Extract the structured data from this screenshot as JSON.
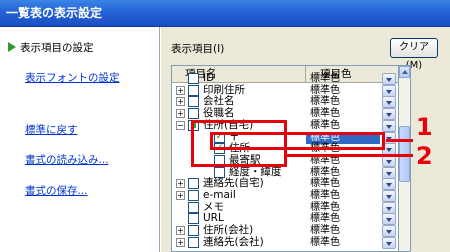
{
  "window": {
    "title": "一覧表の表示設定"
  },
  "sidebar": {
    "current": "表示項目の設定",
    "links": [
      {
        "label": "表示フォントの設定"
      },
      {
        "label": "標準に戻す"
      },
      {
        "label": "書式の読み込み..."
      },
      {
        "label": "書式の保存..."
      }
    ]
  },
  "main": {
    "label": "表示項目(I)",
    "clear_button": "クリア(M)",
    "columns": {
      "name": "項目名",
      "color": "項目色"
    },
    "rows": [
      {
        "name": "ID",
        "color": "標準色",
        "expander": "",
        "checked": false
      },
      {
        "name": "印刷住所",
        "color": "標準色",
        "expander": "+",
        "checked": false
      },
      {
        "name": "会社名",
        "color": "標準色",
        "expander": "+",
        "checked": false
      },
      {
        "name": "役職名",
        "color": "標準色",
        "expander": "+",
        "checked": false
      },
      {
        "name": "住所(自宅)",
        "color": "標準色",
        "expander": "−",
        "checked": "partial"
      },
      {
        "name": "〒",
        "color": "標準色",
        "expander": "",
        "checked": true,
        "selected": true
      },
      {
        "name": "住所",
        "color": "標準色",
        "expander": "",
        "checked": true
      },
      {
        "name": "最寄駅",
        "color": "標準色",
        "expander": "",
        "checked": false
      },
      {
        "name": "経度・緯度",
        "color": "標準色",
        "expander": "",
        "checked": false
      },
      {
        "name": "連絡先(自宅)",
        "color": "標準色",
        "expander": "+",
        "checked": false
      },
      {
        "name": "e-mail",
        "color": "標準色",
        "expander": "+",
        "checked": false
      },
      {
        "name": "メモ",
        "color": "標準色",
        "expander": "",
        "checked": false
      },
      {
        "name": "URL",
        "color": "標準色",
        "expander": "",
        "checked": false
      },
      {
        "name": "住所(会社)",
        "color": "標準色",
        "expander": "+",
        "checked": false
      },
      {
        "name": "連絡先(会社)",
        "color": "標準色",
        "expander": "+",
        "checked": false
      }
    ]
  },
  "callouts": [
    {
      "number": "1"
    },
    {
      "number": "2"
    }
  ],
  "colors": {
    "title_bar": "#2461d6",
    "link": "#0033cc",
    "callout": "#e8000b",
    "selection": "#316ac5",
    "check": "#1b8a1b"
  },
  "icons": {
    "current_marker": "green-arrow-icon",
    "expand": "plus-box-icon",
    "collapse": "minus-box-icon",
    "dropdown": "chevron-down-icon"
  }
}
